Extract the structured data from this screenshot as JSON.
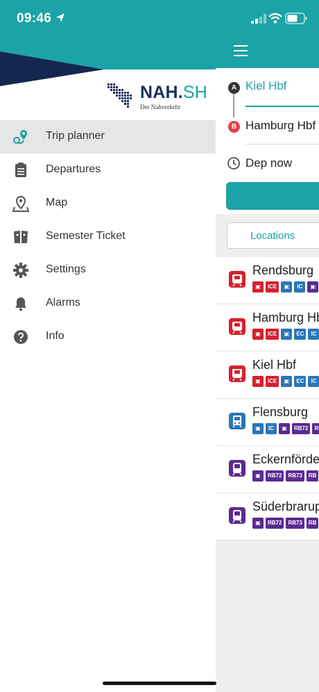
{
  "status_bar": {
    "time": "09:46"
  },
  "colors": {
    "brand_teal": "#1ba3a6",
    "brand_navy": "#1c2e5e",
    "regional_red": "#d6202e",
    "ic_blue": "#2b76b7",
    "rb_purple": "#5b2a91"
  },
  "drawer": {
    "logo": {
      "brand_main": "NAH.",
      "brand_accent": "SH",
      "subtitle": "Der Nahverkehr"
    },
    "items": [
      {
        "label": "Trip planner",
        "icon": "trip-planner-icon",
        "active": true
      },
      {
        "label": "Departures",
        "icon": "departures-icon",
        "active": false
      },
      {
        "label": "Map",
        "icon": "map-icon",
        "active": false
      },
      {
        "label": "Semester Ticket",
        "icon": "ticket-icon",
        "active": false
      },
      {
        "label": "Settings",
        "icon": "gear-icon",
        "active": false
      },
      {
        "label": "Alarms",
        "icon": "bell-icon",
        "active": false
      },
      {
        "label": "Info",
        "icon": "help-icon",
        "active": false
      }
    ]
  },
  "trip_form": {
    "pin_a": "A",
    "pin_b": "B",
    "from": "Kiel Hbf",
    "to": "Hamburg Hbf",
    "departure": "Dep now"
  },
  "tabs": {
    "locations": "Locations"
  },
  "results": [
    {
      "name": "Rendsburg",
      "kind": "regional",
      "badges": [
        "reg",
        "ICE",
        "ic",
        "IC",
        "rb"
      ]
    },
    {
      "name": "Hamburg Hbf",
      "kind": "regional",
      "badges": [
        "reg",
        "ICE",
        "ic",
        "EC",
        "IC"
      ]
    },
    {
      "name": "Kiel Hbf",
      "kind": "regional",
      "badges": [
        "reg",
        "ICE",
        "ic",
        "EC",
        "IC"
      ]
    },
    {
      "name": "Flensburg",
      "kind": "ic",
      "badges": [
        "ic",
        "IC",
        "rb",
        "RB72",
        "RB"
      ]
    },
    {
      "name": "Eckernförde",
      "kind": "rb",
      "badges": [
        "rb",
        "RB72",
        "RB73",
        "RB"
      ]
    },
    {
      "name": "Süderbrarup",
      "kind": "rb",
      "badges": [
        "rb",
        "RB72",
        "RB73",
        "RB"
      ]
    }
  ]
}
